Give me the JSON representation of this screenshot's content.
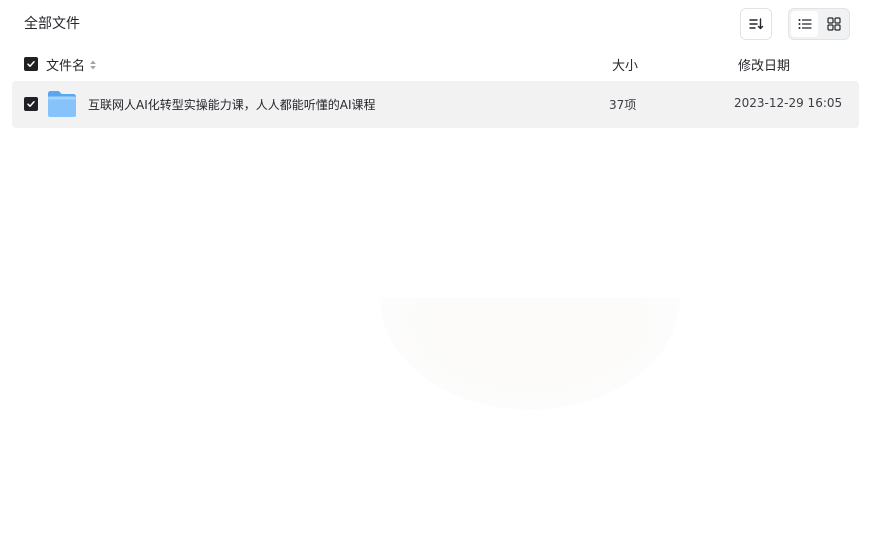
{
  "breadcrumb": {
    "label": "全部文件"
  },
  "toolbar": {
    "sort_icon": "sort-list-icon",
    "view_list_icon": "list-view-icon",
    "view_grid_icon": "grid-view-icon",
    "active_view": "list"
  },
  "table": {
    "headers": {
      "name": "文件名",
      "size": "大小",
      "modified": "修改日期"
    },
    "select_all_checked": true,
    "rows": [
      {
        "checked": true,
        "icon": "folder-icon",
        "name": "互联网人AI化转型实操能力课，人人都能听懂的AI课程",
        "size": "37项",
        "modified": "2023-12-29 16:05"
      }
    ]
  },
  "colors": {
    "checkbox": "#1f2024",
    "row_highlight": "#f2f2f3",
    "folder": "#7fbfff"
  }
}
